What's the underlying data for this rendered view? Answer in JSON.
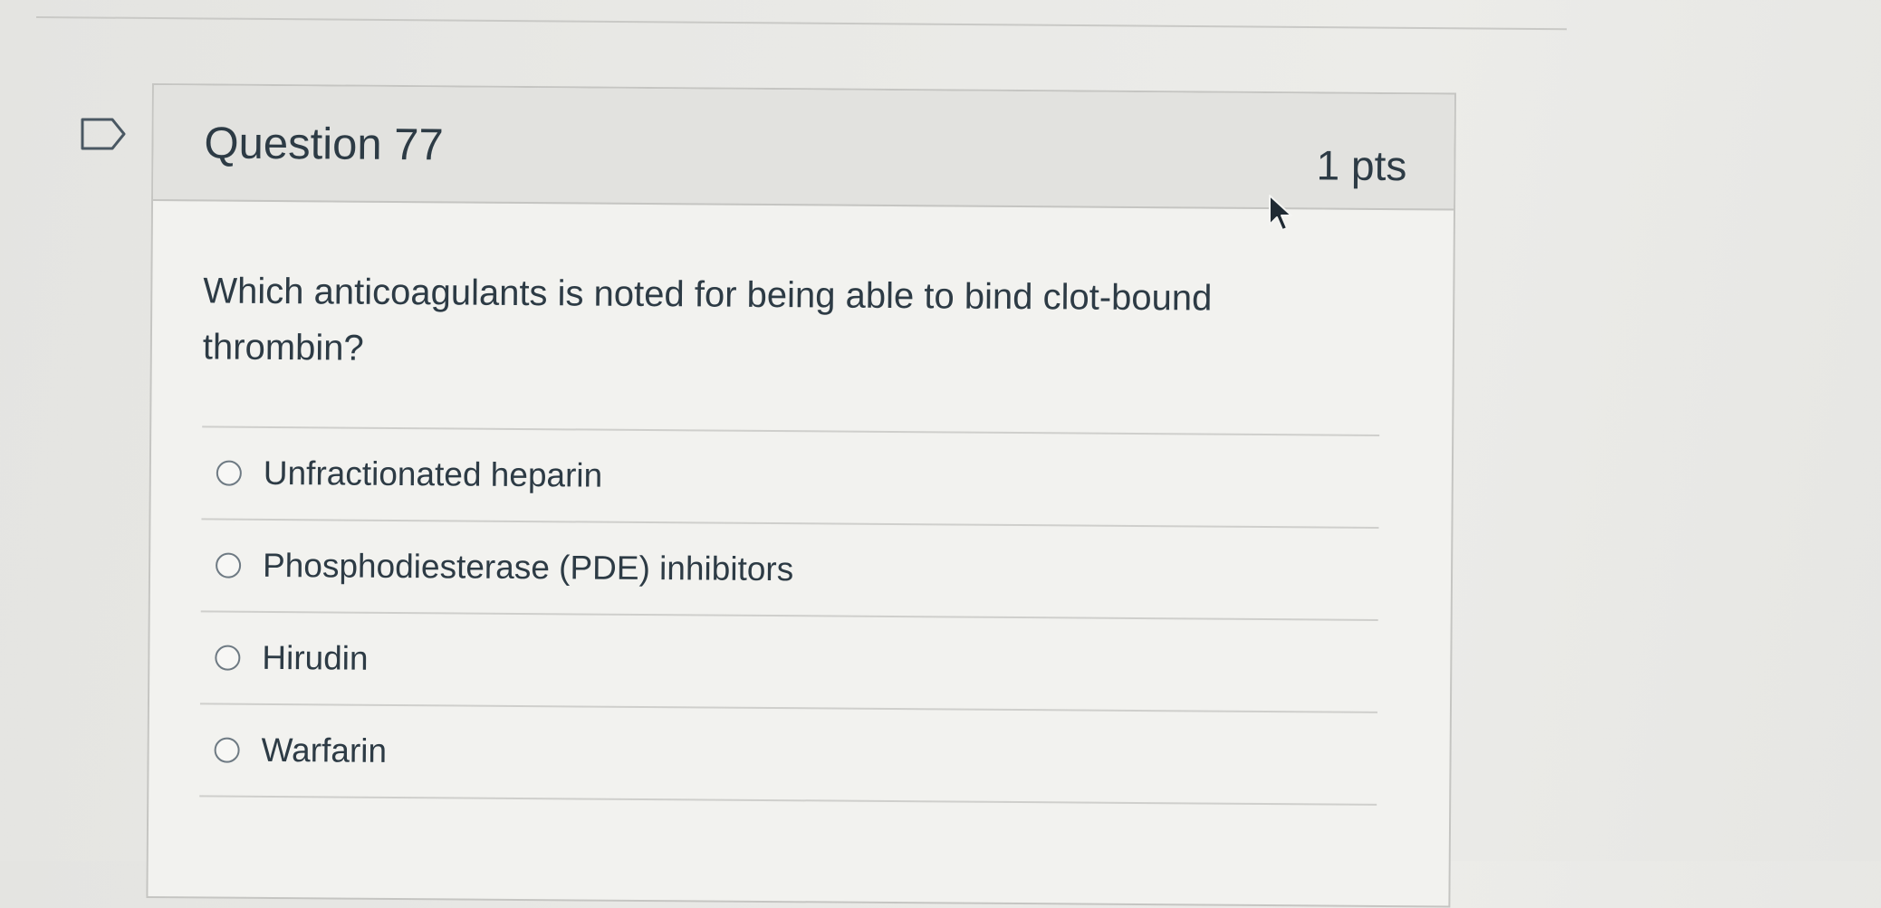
{
  "question": {
    "title": "Question 77",
    "points": "1 pts",
    "text": "Which anticoagulants is noted for being able to bind clot-bound thrombin?",
    "answers": [
      {
        "label": "Unfractionated heparin",
        "selected": false
      },
      {
        "label": "Phosphodiesterase (PDE) inhibitors",
        "selected": false
      },
      {
        "label": "Hirudin",
        "selected": false
      },
      {
        "label": "Warfarin",
        "selected": false
      }
    ]
  },
  "icons": {
    "flag": "flag-question-icon",
    "cursor": "mouse-pointer-icon"
  },
  "colors": {
    "text": "#2d3b45",
    "header_bg": "#e2e2df",
    "card_bg": "#f2f2ef",
    "border": "#c5c5c2"
  }
}
